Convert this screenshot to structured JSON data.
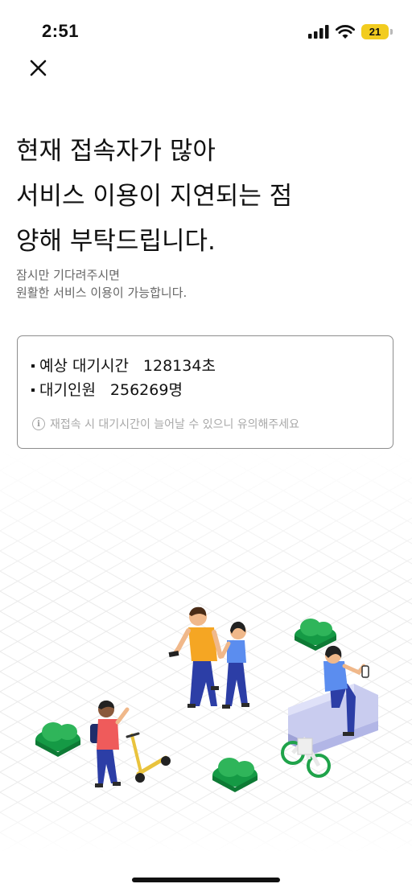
{
  "status_bar": {
    "time": "2:51",
    "battery": "21"
  },
  "headline": {
    "line1": "현재 접속자가 많아",
    "line2": "서비스 이용이 지연되는 점",
    "line3": "양해 부탁드립니다."
  },
  "subtext": {
    "line1": "잠시만 기다려주시면",
    "line2": "원활한 서비스 이용이 가능합니다."
  },
  "wait_info": {
    "time_label": "예상 대기시간",
    "time_value": "128134초",
    "people_label": "대기인원",
    "people_value": "256269명",
    "notice": "재접속 시 대기시간이 늘어날 수 있으니 유의해주세요"
  },
  "colors": {
    "accent_green": "#1fa34a",
    "battery_yellow": "#f2cc1f"
  },
  "icons": {
    "close": "close-icon",
    "notice": "info-icon",
    "signal": "signal-icon",
    "wifi": "wifi-icon"
  }
}
